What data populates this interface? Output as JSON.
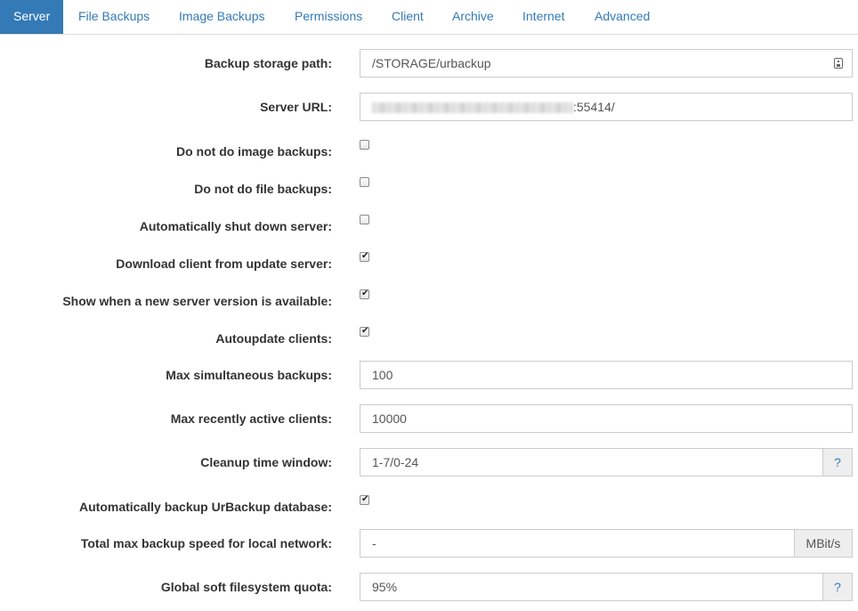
{
  "tabs": [
    "Server",
    "File Backups",
    "Image Backups",
    "Permissions",
    "Client",
    "Archive",
    "Internet",
    "Advanced"
  ],
  "form": {
    "backup_storage_path": {
      "label": "Backup storage path:",
      "value": "/STORAGE/urbackup"
    },
    "server_url": {
      "label": "Server URL:",
      "value_suffix": ":55414/"
    },
    "no_image_backups": {
      "label": "Do not do image backups:",
      "checked": false
    },
    "no_file_backups": {
      "label": "Do not do file backups:",
      "checked": false
    },
    "auto_shutdown": {
      "label": "Automatically shut down server:",
      "checked": false
    },
    "download_client": {
      "label": "Download client from update server:",
      "checked": true
    },
    "show_new_version": {
      "label": "Show when a new server version is available:",
      "checked": true
    },
    "autoupdate_clients": {
      "label": "Autoupdate clients:",
      "checked": true
    },
    "max_simultaneous": {
      "label": "Max simultaneous backups:",
      "value": "100"
    },
    "max_recently_active": {
      "label": "Max recently active clients:",
      "value": "10000"
    },
    "cleanup_window": {
      "label": "Cleanup time window:",
      "value": "1-7/0-24",
      "help": "?"
    },
    "auto_backup_db": {
      "label": "Automatically backup UrBackup database:",
      "checked": true
    },
    "max_speed_local": {
      "label": "Total max backup speed for local network:",
      "value": "-",
      "unit": "MBit/s"
    },
    "soft_quota": {
      "label": "Global soft filesystem quota:",
      "value": "95%",
      "help": "?"
    }
  }
}
